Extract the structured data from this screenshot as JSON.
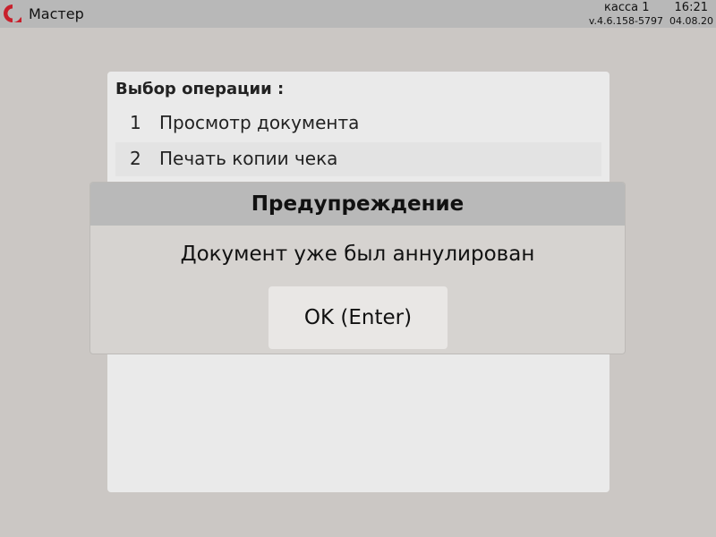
{
  "topbar": {
    "app_title": "Мастер",
    "register": "касса 1",
    "time": "16:21",
    "version": "v.4.6.158-5797",
    "date": "04.08.20",
    "logo_color": "#c8202c"
  },
  "menu": {
    "heading": "Выбор операции :",
    "items": [
      {
        "number": "1",
        "label": "Просмотр документа"
      },
      {
        "number": "2",
        "label": "Печать копии чека"
      }
    ]
  },
  "dialog": {
    "title": "Предупреждение",
    "message": "Документ уже был аннулирован",
    "ok_label": "OK (Enter)"
  }
}
